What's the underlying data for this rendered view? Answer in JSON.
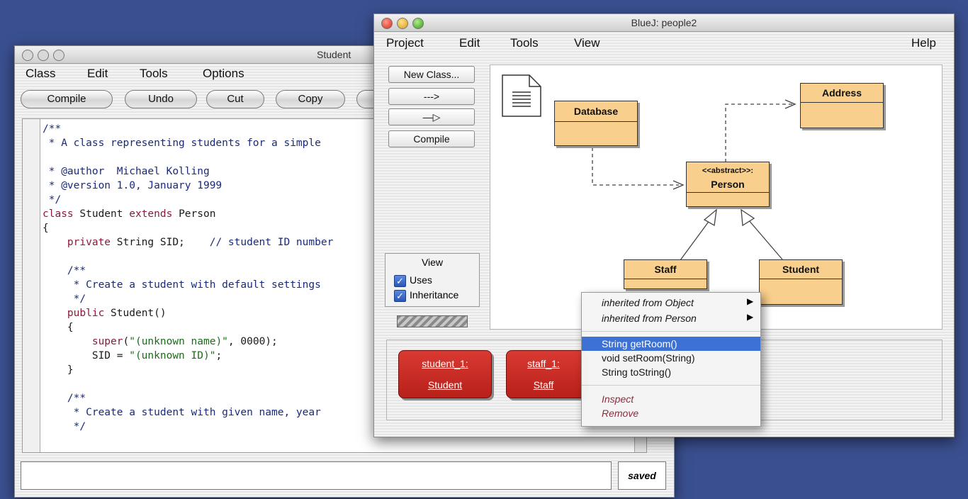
{
  "editor": {
    "title": "Student",
    "menu": [
      "Class",
      "Edit",
      "Tools",
      "Options"
    ],
    "toolbar": [
      "Compile",
      "Undo",
      "Cut",
      "Copy"
    ],
    "status": "saved"
  },
  "bluej": {
    "title": "BlueJ:  people2",
    "menu": [
      "Project",
      "Edit",
      "Tools",
      "View",
      "Help"
    ],
    "side_buttons": [
      "New Class...",
      "--->",
      "—▷",
      "Compile"
    ],
    "view_panel": {
      "title": "View",
      "uses": "Uses",
      "inheritance": "Inheritance"
    },
    "classes": {
      "database": "Database",
      "address": "Address",
      "person_stereotype": "<<abstract>>:",
      "person": "Person",
      "staff": "Staff",
      "student": "Student"
    },
    "objects": [
      {
        "name": "student_1:",
        "type": "Student"
      },
      {
        "name": "staff_1:",
        "type": "Staff"
      }
    ],
    "context_menu": {
      "inherited_object": "inherited from Object",
      "inherited_person": "inherited from Person",
      "methods": [
        "String getRoom()",
        "void setRoom(String)",
        "String toString()"
      ],
      "inspect": "Inspect",
      "remove": "Remove"
    }
  },
  "colors": {
    "desktop": "#3a4f8f",
    "class_fill": "#f8cf8c",
    "object_fill": "#c8261f",
    "menu_highlight": "#3b6fd4"
  }
}
